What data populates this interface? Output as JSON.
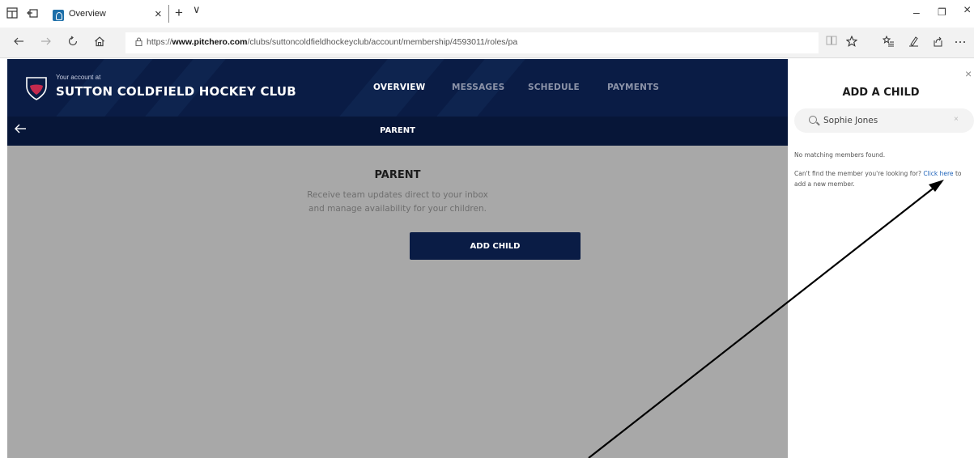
{
  "browser": {
    "tab_title": "Overview",
    "tab_close": "×",
    "new_tab": "+",
    "tab_menu": "∨",
    "url_prefix": "https://",
    "url_domain": "www.pitchero.com",
    "url_path": "/clubs/suttoncoldfieldhockeyclub/account/membership/4593011/roles/pa",
    "window_controls": {
      "minimize": "–",
      "restore": "❐",
      "close": "×"
    },
    "icons": {
      "tab_actions": "tab-actions-icon",
      "set_aside": "set-aside-tabs-icon",
      "favicon": "pitchero-favicon",
      "back": "back-arrow-icon",
      "forward": "forward-arrow-icon",
      "refresh": "refresh-icon",
      "home": "home-icon",
      "lock": "lock-icon",
      "reading_view": "reading-view-icon",
      "favorite": "star-icon",
      "favorites_list": "favorites-list-icon",
      "notes": "pen-icon",
      "share": "share-icon",
      "more": "more-icon"
    }
  },
  "club": {
    "account_label": "Your account at",
    "name": "SUTTON COLDFIELD HOCKEY CLUB",
    "brand_color": "#0a1c45",
    "nav": [
      {
        "label": "OVERVIEW",
        "active": true
      },
      {
        "label": "MESSAGES",
        "active": false
      },
      {
        "label": "SCHEDULE",
        "active": false
      },
      {
        "label": "PAYMENTS",
        "active": false
      }
    ]
  },
  "subheader": {
    "title": "PARENT"
  },
  "main": {
    "title": "PARENT",
    "description_line1": "Receive team updates direct to your inbox",
    "description_line2": "and manage availability for your children.",
    "add_child_button": "ADD CHILD"
  },
  "panel": {
    "close": "×",
    "title": "ADD A CHILD",
    "search_value": "Sophie Jones",
    "search_clear": "×",
    "no_match": "No matching members found.",
    "cant_find_prefix": "Can't find the member you're looking for?",
    "link_text": "Click here",
    "cant_find_suffix": "to add a new member.",
    "link_color": "#1c62b9"
  }
}
